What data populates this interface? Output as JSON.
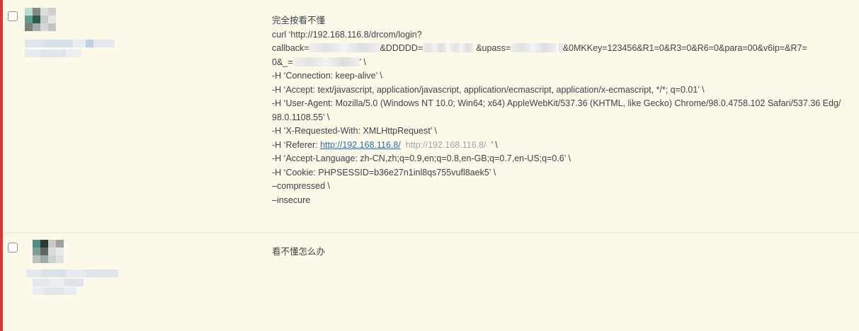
{
  "colors": {
    "accent": "#d63638",
    "background": "#fcf9e8",
    "link": "#2271b1"
  },
  "comments": [
    {
      "title": "完全按看不懂",
      "curl_line1": "curl ‘http://192.168.116.8/drcom/login?",
      "callback_label": "callback=",
      "ddddd_param": "&DDDDD=",
      "upass_param": "&upass=",
      "params_tail": "&0MKKey=123456&R1=0&R3=0&R6=0&para=00&v6ip=&R7=",
      "underscore_param": "0&_=",
      "quote_close": "’ \\",
      "h_connection": "-H ‘Connection: keep-alive’ \\",
      "h_accept": "-H ‘Accept: text/javascript, application/javascript, application/ecmascript, application/x-ecmascript, */*; q=0.01’ \\",
      "h_user_agent": "-H ‘User-Agent: Mozilla/5.0 (Windows NT 10.0; Win64; x64) AppleWebKit/537.36 (KHTML, like Gecko) Chrome/98.0.4758.102 Safari/537.36 Edg/98.0.1108.55’ \\",
      "h_xrw": "-H ‘X-Requested-With: XMLHttpRequest’ \\",
      "h_referer_prefix": "-H ‘Referer: ",
      "referer_link": "http://192.168.116.8/",
      "referer_plain": "http://192.168.116.8/",
      "referer_suffix": "’ \\",
      "h_accept_language": "-H ‘Accept-Language: zh-CN,zh;q=0.9,en;q=0.8,en-GB;q=0.7,en-US;q=0.6’ \\",
      "h_cookie": "-H ‘Cookie: PHPSESSID=b36e27n1inl8qs755vufl8aek5’ \\",
      "compressed": "–compressed \\",
      "insecure": "–insecure"
    },
    {
      "text": "看不懂怎么办"
    }
  ]
}
